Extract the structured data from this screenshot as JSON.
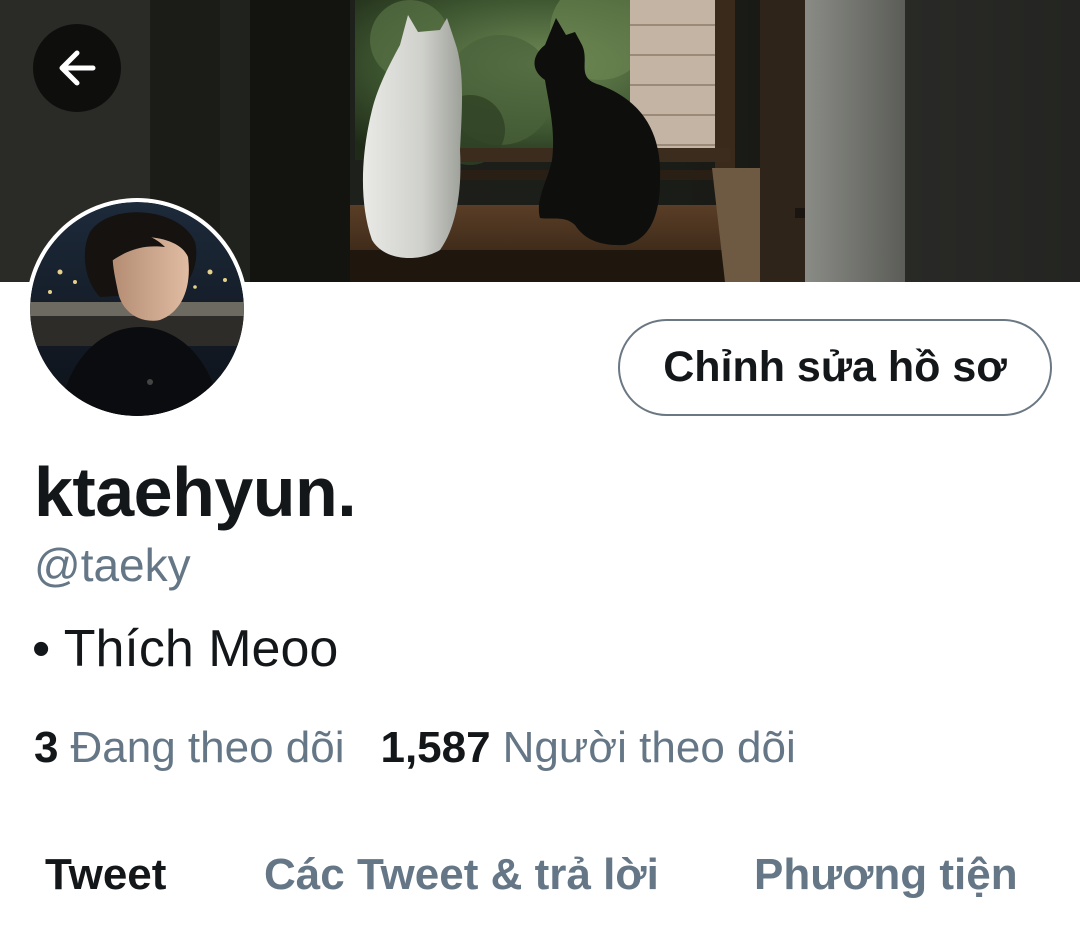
{
  "header": {
    "back_icon": "arrow-left-icon",
    "banner_image": "two cats sitting on a windowsill"
  },
  "profile": {
    "avatar_image": "profile photo",
    "edit_button_label": "Chỉnh sửa hồ sơ",
    "display_name": "ktaehyun.",
    "handle": "@taeky",
    "bio": "• Thích Meoo",
    "following_count": "3",
    "following_label": "Đang theo dõi",
    "followers_count": "1,587",
    "followers_label": "Người theo dõi"
  },
  "tabs": [
    {
      "label": "Tweet",
      "active": true
    },
    {
      "label": "Các Tweet & trả lời",
      "active": false
    },
    {
      "label": "Phương tiện",
      "active": false
    }
  ],
  "colors": {
    "text_primary": "#14171a",
    "text_secondary": "#657786",
    "button_border": "#6b7883",
    "background": "#ffffff"
  }
}
